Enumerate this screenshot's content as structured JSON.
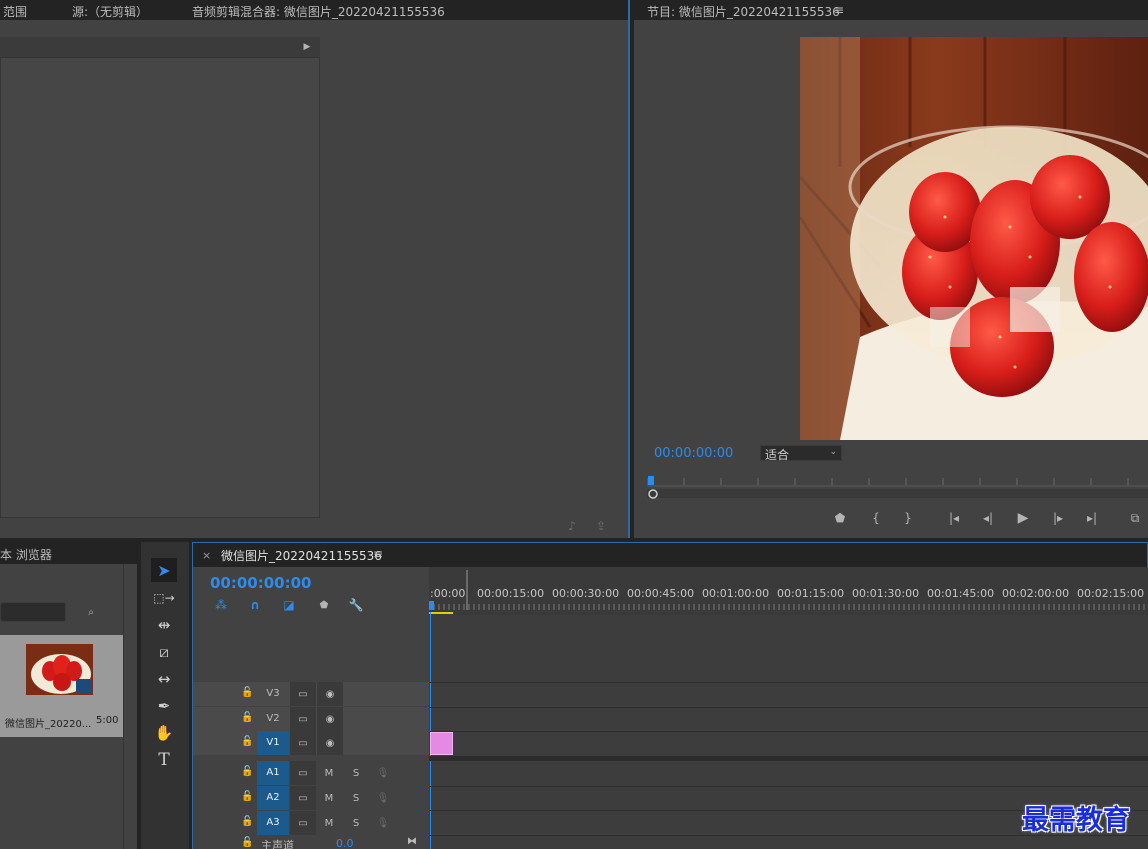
{
  "top_tabs": {
    "left_partial": "范围",
    "source": "源:（无剪辑）",
    "audio_mixer": "音频剪辑混合器: 微信图片_20220421155536"
  },
  "program_monitor": {
    "title": "节目: 微信图片_20220421155536",
    "menu_icon": "≡",
    "timecode": "00:00:00:00",
    "zoom_select": "适合",
    "transport": [
      "marker-icon",
      "mark-in-icon",
      "mark-out-icon",
      "go-to-in-icon",
      "step-back-icon",
      "play-icon",
      "step-forward-icon",
      "go-to-out-icon",
      "export-frame-icon"
    ]
  },
  "media_browser": {
    "title": "本 浏览器",
    "clip_name": "微信图片_20220...",
    "clip_duration": "5:00"
  },
  "timeline": {
    "close": "×",
    "title": "微信图片_20220421155536",
    "menu_icon": "≡",
    "timecode": "00:00:00:00",
    "ruler_labels": [
      ":00:00",
      "00:00:15:00",
      "00:00:30:00",
      "00:00:45:00",
      "00:01:00:00",
      "00:01:15:00",
      "00:01:30:00",
      "00:01:45:00",
      "00:02:00:00",
      "00:02:15:00"
    ],
    "video_tracks": [
      {
        "name": "V3",
        "active": false
      },
      {
        "name": "V2",
        "active": false
      },
      {
        "name": "V1",
        "active": true
      }
    ],
    "audio_tracks": [
      {
        "name": "A1",
        "m": "M",
        "s": "S"
      },
      {
        "name": "A2",
        "m": "M",
        "s": "S"
      },
      {
        "name": "A3",
        "m": "M",
        "s": "S"
      }
    ],
    "master_label": "主声道",
    "master_value": "0.0"
  },
  "watermark": "最需教育",
  "colors": {
    "accent_blue": "#2d8ceb",
    "clip_pink": "#e58ae4",
    "track_active": "#1d5a8c"
  }
}
